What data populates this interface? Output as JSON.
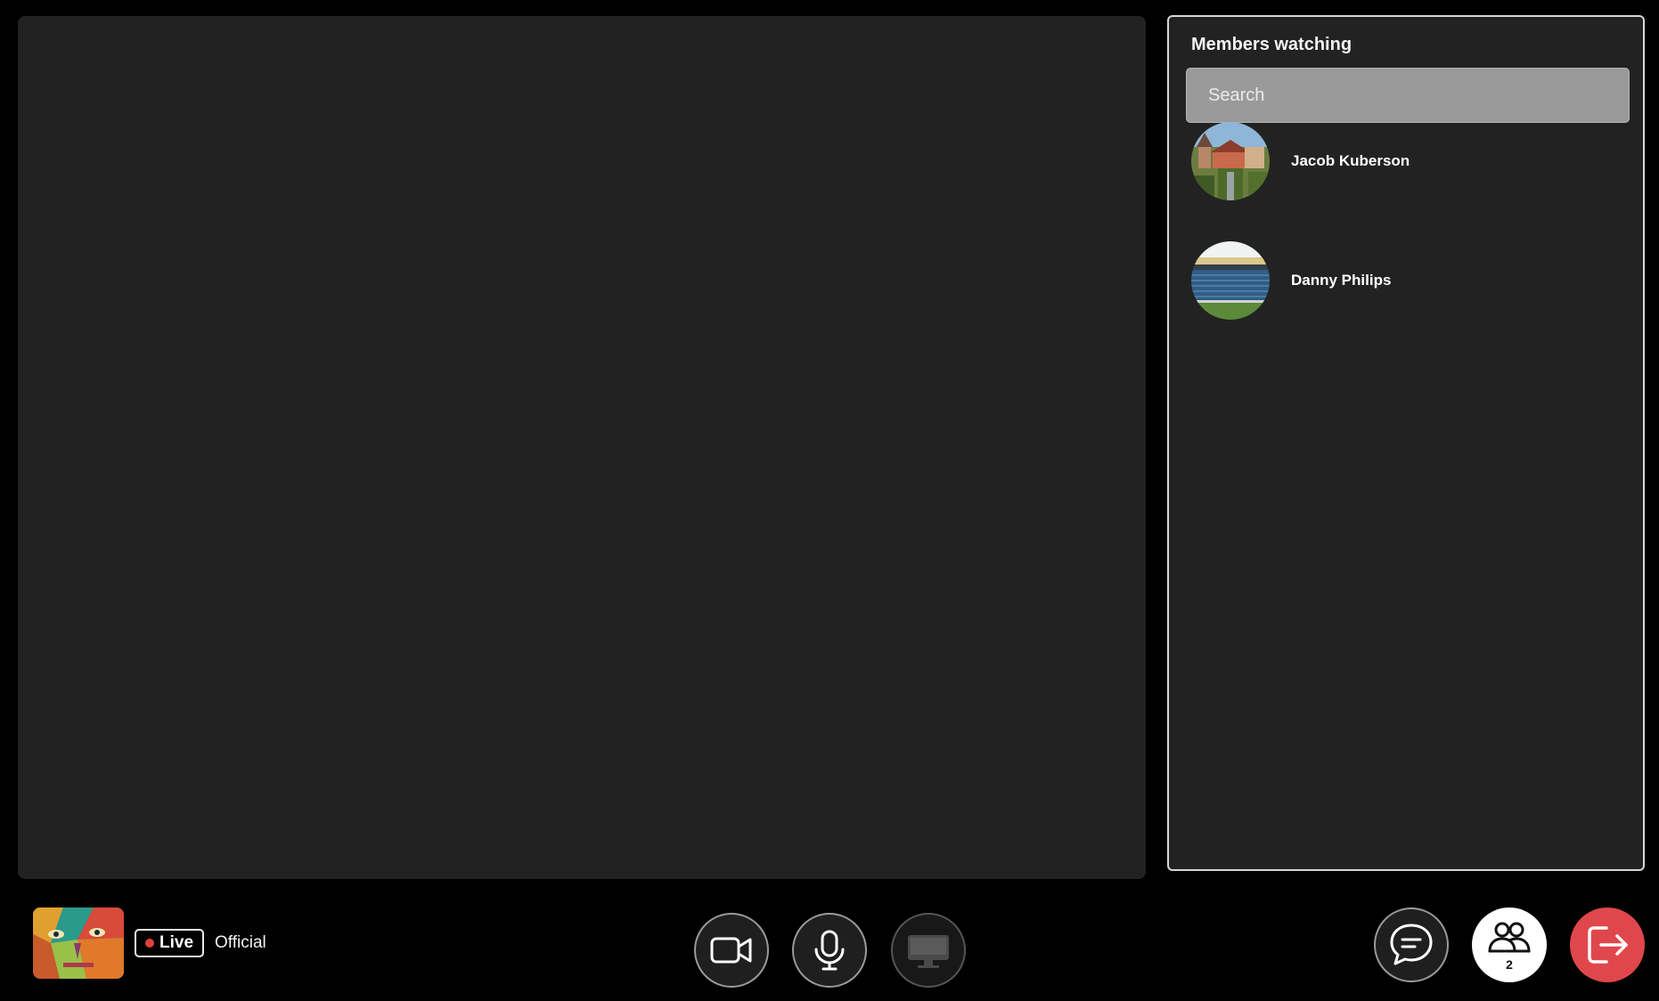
{
  "members_panel": {
    "title": "Members watching",
    "search_placeholder": "Search",
    "members": [
      {
        "name": "Jacob Kuberson",
        "avatar": "castle-town-photo"
      },
      {
        "name": "Danny Philips",
        "avatar": "stadium-photo"
      }
    ]
  },
  "channel": {
    "live_label": "Live",
    "name": "Official",
    "thumbnail": "abstract-faces-art",
    "live_dot_color": "#e0423a"
  },
  "controls": {
    "camera_icon": "video-camera-icon",
    "mic_icon": "microphone-icon",
    "screen_icon": "monitor-icon",
    "chat_icon": "chat-icon",
    "members_icon": "people-icon",
    "members_count": "2",
    "leave_icon": "exit-icon",
    "leave_color": "#e0474c"
  }
}
